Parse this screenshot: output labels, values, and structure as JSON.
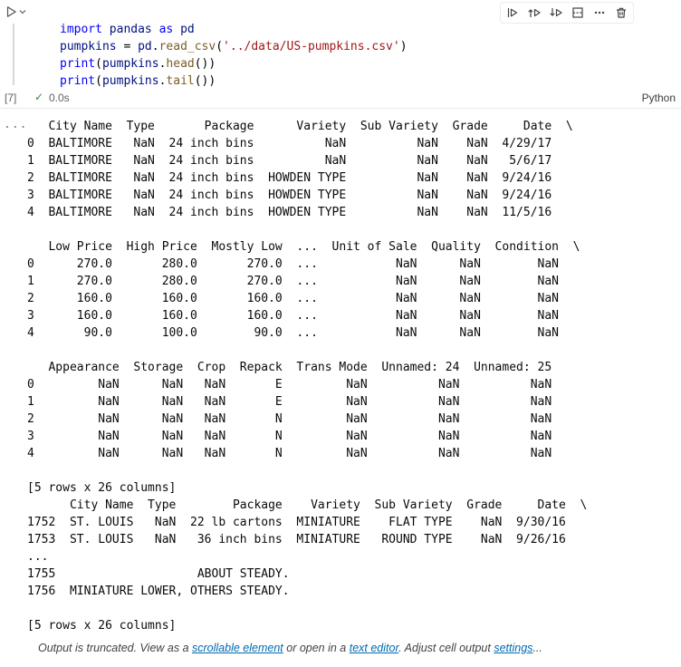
{
  "cell": {
    "toolbar_icons": [
      "run-by-line",
      "execute-above",
      "execute-cell-and-below",
      "split-cell",
      "more-actions",
      "delete-cell"
    ],
    "code": [
      [
        {
          "t": "import",
          "c": "kw"
        },
        {
          "t": " ",
          "c": "pl"
        },
        {
          "t": "pandas",
          "c": "var"
        },
        {
          "t": " ",
          "c": "pl"
        },
        {
          "t": "as",
          "c": "kw"
        },
        {
          "t": " ",
          "c": "pl"
        },
        {
          "t": "pd",
          "c": "var"
        }
      ],
      [
        {
          "t": "pumpkins",
          "c": "var"
        },
        {
          "t": " = ",
          "c": "pl"
        },
        {
          "t": "pd",
          "c": "var"
        },
        {
          "t": ".",
          "c": "pl"
        },
        {
          "t": "read_csv",
          "c": "fn"
        },
        {
          "t": "(",
          "c": "pl"
        },
        {
          "t": "'../data/US-pumpkins.csv'",
          "c": "str"
        },
        {
          "t": ")",
          "c": "pl"
        }
      ],
      [
        {
          "t": "print",
          "c": "kw"
        },
        {
          "t": "(",
          "c": "pl"
        },
        {
          "t": "pumpkins",
          "c": "var"
        },
        {
          "t": ".",
          "c": "pl"
        },
        {
          "t": "head",
          "c": "fn"
        },
        {
          "t": "())",
          "c": "pl"
        }
      ],
      [
        {
          "t": "print",
          "c": "kw"
        },
        {
          "t": "(",
          "c": "pl"
        },
        {
          "t": "pumpkins",
          "c": "var"
        },
        {
          "t": ".",
          "c": "pl"
        },
        {
          "t": "tail",
          "c": "fn"
        },
        {
          "t": "())",
          "c": "pl"
        }
      ]
    ],
    "exec_count": "[7]",
    "exec_status": "✓",
    "exec_time": "0.0s",
    "language": "Python"
  },
  "output": {
    "options_label": "...",
    "lines": [
      "   City Name  Type       Package      Variety  Sub Variety  Grade     Date  \\",
      "0  BALTIMORE   NaN  24 inch bins          NaN          NaN    NaN  4/29/17",
      "1  BALTIMORE   NaN  24 inch bins          NaN          NaN    NaN   5/6/17",
      "2  BALTIMORE   NaN  24 inch bins  HOWDEN TYPE          NaN    NaN  9/24/16",
      "3  BALTIMORE   NaN  24 inch bins  HOWDEN TYPE          NaN    NaN  9/24/16",
      "4  BALTIMORE   NaN  24 inch bins  HOWDEN TYPE          NaN    NaN  11/5/16",
      "",
      "   Low Price  High Price  Mostly Low  ...  Unit of Sale  Quality  Condition  \\",
      "0      270.0       280.0       270.0  ...           NaN      NaN        NaN",
      "1      270.0       280.0       270.0  ...           NaN      NaN        NaN",
      "2      160.0       160.0       160.0  ...           NaN      NaN        NaN",
      "3      160.0       160.0       160.0  ...           NaN      NaN        NaN",
      "4       90.0       100.0        90.0  ...           NaN      NaN        NaN",
      "",
      "   Appearance  Storage  Crop  Repack  Trans Mode  Unnamed: 24  Unnamed: 25",
      "0         NaN      NaN   NaN       E         NaN          NaN          NaN",
      "1         NaN      NaN   NaN       E         NaN          NaN          NaN",
      "2         NaN      NaN   NaN       N         NaN          NaN          NaN",
      "3         NaN      NaN   NaN       N         NaN          NaN          NaN",
      "4         NaN      NaN   NaN       N         NaN          NaN          NaN",
      "",
      "[5 rows x 26 columns]",
      "      City Name  Type        Package    Variety  Sub Variety  Grade     Date  \\",
      "1752  ST. LOUIS   NaN  22 lb cartons  MINIATURE    FLAT TYPE    NaN  9/30/16",
      "1753  ST. LOUIS   NaN   36 inch bins  MINIATURE   ROUND TYPE    NaN  9/26/16",
      "...",
      "1755                    ABOUT STEADY.",
      "1756  MINIATURE LOWER, OTHERS STEADY.",
      "",
      "[5 rows x 26 columns]"
    ],
    "truncation": {
      "prefix": "Output is truncated. View as a ",
      "link_scrollable": "scrollable element",
      "mid1": " or open in a ",
      "link_text_editor": "text editor",
      "mid2": ". Adjust cell output ",
      "link_settings": "settings",
      "suffix": "..."
    }
  }
}
